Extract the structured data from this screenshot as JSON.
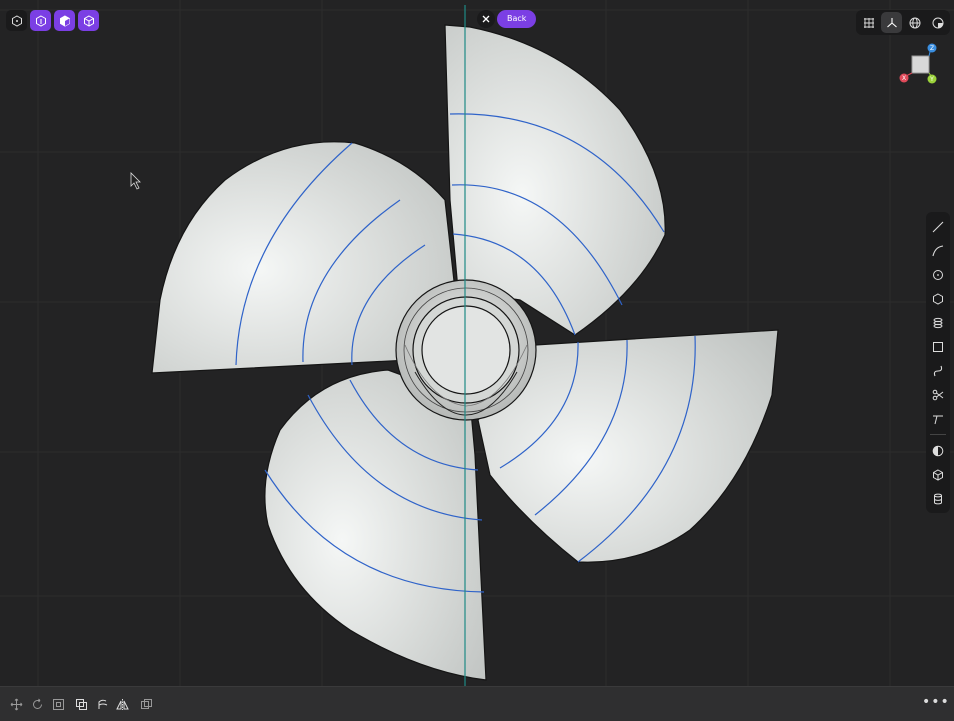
{
  "toolbar": {
    "left_buttons": [
      {
        "icon": "hexagon-icon",
        "active": false
      },
      {
        "icon": "cube-front-icon",
        "active": true
      },
      {
        "icon": "cube-iso-icon",
        "active": true
      },
      {
        "icon": "cube-outline-icon",
        "active": true
      }
    ],
    "close_icon": "close-icon",
    "back_label": "Back",
    "right_buttons": [
      {
        "icon": "grid-icon",
        "active": false
      },
      {
        "icon": "axes-icon",
        "active": true
      },
      {
        "icon": "wireframe-sphere-icon",
        "active": false
      },
      {
        "icon": "render-sphere-icon",
        "active": false
      }
    ]
  },
  "gizmo": {
    "x_label": "X",
    "y_label": "Y",
    "z_label": "Z",
    "x_color": "#e04a5a",
    "y_color": "#9bd23a",
    "z_color": "#3a8ee0"
  },
  "side_tools": [
    "line-icon",
    "curve-icon",
    "circle-icon",
    "polygon-icon",
    "cylinder-icon",
    "rectangle-icon",
    "spline-icon",
    "scissors-icon",
    "trim-icon",
    "sphere-half-icon",
    "box-icon",
    "barrel-icon"
  ],
  "bottom_tools": [
    "move-icon",
    "rotate-icon",
    "scale-icon",
    "copy-icon",
    "revolve-icon",
    "mirror-icon",
    "array-icon"
  ],
  "more_label": "•••",
  "colors": {
    "accent": "#7b3fe4",
    "background": "#232324",
    "blade": "#d6d9d7",
    "isoline": "#2f63c9",
    "axis": "#1e8a86"
  }
}
